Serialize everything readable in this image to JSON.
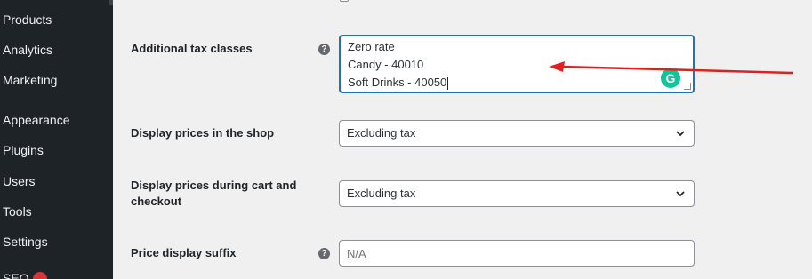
{
  "sidebar": {
    "items": [
      {
        "label": "Products"
      },
      {
        "label": "Analytics"
      },
      {
        "label": "Marketing"
      },
      {
        "label": "Appearance"
      },
      {
        "label": "Plugins"
      },
      {
        "label": "Users"
      },
      {
        "label": "Tools"
      },
      {
        "label": "Settings"
      },
      {
        "label": "SEO"
      }
    ]
  },
  "settings": {
    "tax_classes": {
      "label": "Additional tax classes",
      "lines": [
        "Zero rate",
        "Candy - 40010",
        "Soft Drinks - 40050"
      ]
    },
    "display_shop": {
      "label": "Display prices in the shop",
      "value": "Excluding tax"
    },
    "display_cart": {
      "label_line1": "Display prices during cart and",
      "label_line2": "checkout",
      "value": "Excluding tax"
    },
    "price_suffix": {
      "label": "Price display suffix",
      "placeholder": "N/A"
    }
  },
  "icons": {
    "help": "question-mark-icon",
    "grammarly": "grammarly-icon",
    "chevron": "chevron-down-icon"
  },
  "colors": {
    "sidebar_bg": "#1d2327",
    "focus_border": "#2271b1",
    "annotation_arrow": "#e02020",
    "grammarly": "#15c39a"
  }
}
